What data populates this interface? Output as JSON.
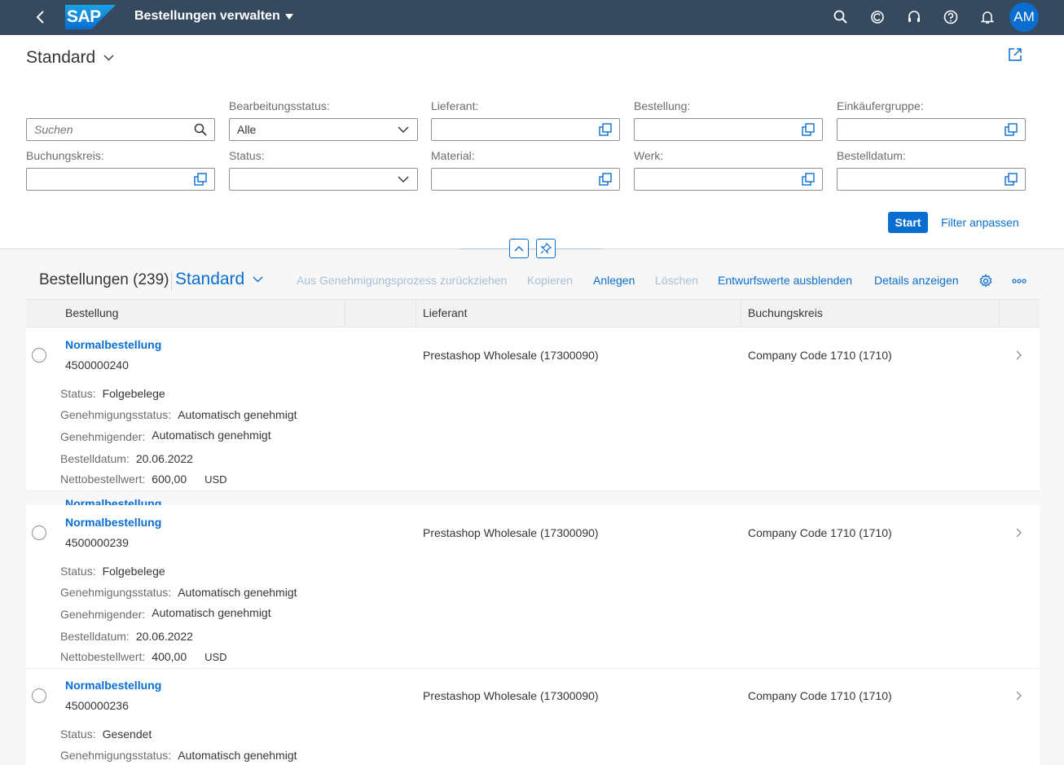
{
  "shell": {
    "app_title": "Bestellungen verwalten",
    "logo_text": "SAP",
    "avatar_initials": "AM"
  },
  "header": {
    "variant_name": "Standard"
  },
  "filters": {
    "search_placeholder": "Suchen",
    "processing_status_label": "Bearbeitungsstatus:",
    "processing_status_value": "Alle",
    "supplier_label": "Lieferant:",
    "order_label": "Bestellung:",
    "purchasing_group_label": "Einkäufergruppe:",
    "company_code_label": "Buchungskreis:",
    "status_label": "Status:",
    "material_label": "Material:",
    "plant_label": "Werk:",
    "order_date_label": "Bestelldatum:",
    "start_button": "Start",
    "adapt_filters": "Filter anpassen"
  },
  "table": {
    "title": "Bestellungen (239)",
    "variant_name": "Standard",
    "toolbar": {
      "withdraw": "Aus Genehmigungsprozess zurückziehen",
      "copy": "Kopieren",
      "create": "Anlegen",
      "delete": "Löschen",
      "hide_drafts": "Entwurfswerte ausblenden",
      "show_details": "Details anzeigen"
    },
    "columns": {
      "order": "Bestellung",
      "supplier": "Lieferant",
      "company_code": "Buchungskreis"
    },
    "detail_labels": {
      "status": "Status:",
      "approval_status": "Genehmigungsstatus:",
      "approver": "Genehmigender:",
      "order_date": "Bestelldatum:",
      "net_value": "Nettobestellwert:"
    },
    "ghost_text": "Normalbestellung",
    "rows": [
      {
        "type": "Normalbestellung",
        "number": "4500000240",
        "supplier": "Prestashop Wholesale (17300090)",
        "company_code": "Company Code 1710 (1710)",
        "status": "Folgebelege",
        "approval_status": "Automatisch genehmigt",
        "approver": "Automatisch genehmigt",
        "order_date": "20.06.2022",
        "net_value": "600,00",
        "currency": "USD"
      },
      {
        "type": "Normalbestellung",
        "number": "4500000239",
        "supplier": "Prestashop Wholesale (17300090)",
        "company_code": "Company Code 1710 (1710)",
        "status": "Folgebelege",
        "approval_status": "Automatisch genehmigt",
        "approver": "Automatisch genehmigt",
        "order_date": "20.06.2022",
        "net_value": "400,00",
        "currency": "USD"
      },
      {
        "type": "Normalbestellung",
        "number": "4500000236",
        "supplier": "Prestashop Wholesale (17300090)",
        "company_code": "Company Code 1710 (1710)",
        "status": "Gesendet",
        "approval_status": "Automatisch genehmigt"
      }
    ]
  },
  "colors": {
    "shell_bg": "#354a5f",
    "brand_blue": "#0a6ed1",
    "text": "#32363a",
    "label": "#6a6d70"
  },
  "icons": {
    "back": "back-arrow-icon",
    "search": "search-icon",
    "copilot": "copilot-icon",
    "headset": "headset-icon",
    "help": "help-icon",
    "bell": "bell-icon",
    "share": "share-icon",
    "value_help": "value-help-icon",
    "dropdown": "chevron-down-icon",
    "collapse": "chevron-up-icon",
    "pin": "pin-icon",
    "settings": "gear-icon",
    "overflow": "overflow-icon",
    "nav": "chevron-right-icon"
  }
}
